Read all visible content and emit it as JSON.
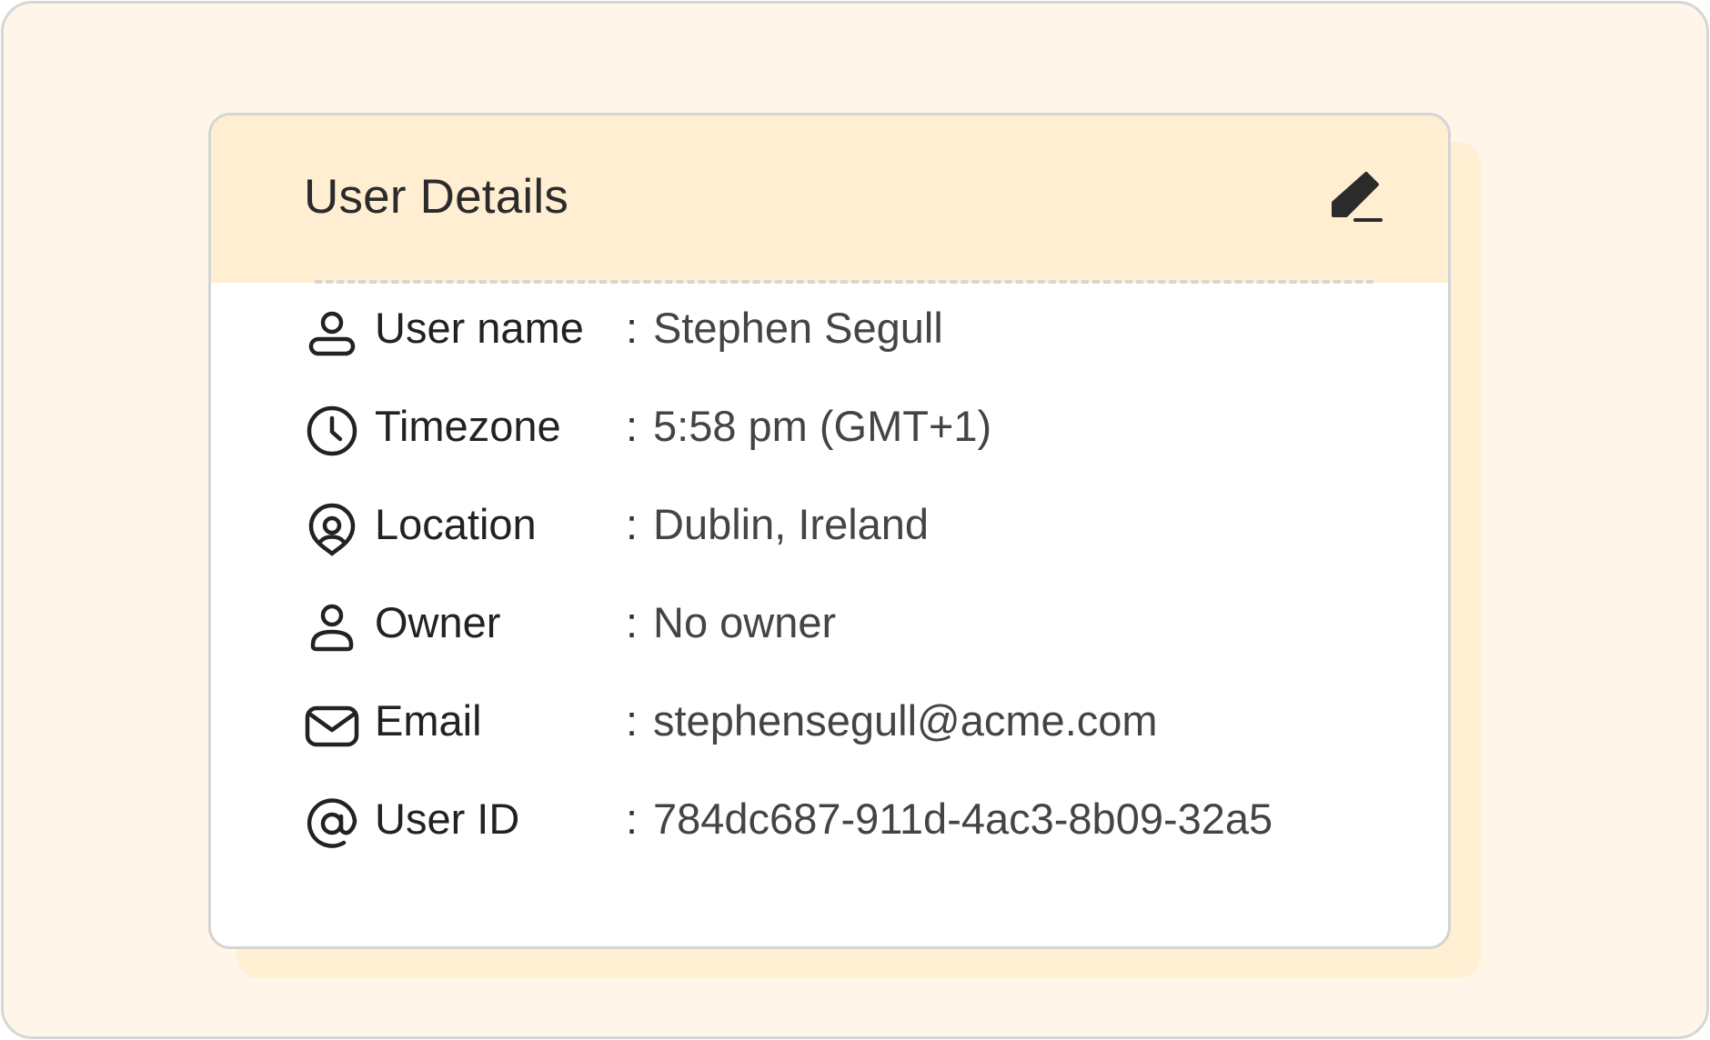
{
  "card": {
    "title": "User Details",
    "edit_icon": "pencil-icon",
    "accent_color": "#ffeed2",
    "background_color": "#fff6e9"
  },
  "fields": [
    {
      "icon": "user-icon",
      "label": "User name",
      "separator": ":",
      "value": "Stephen Segull"
    },
    {
      "icon": "clock-icon",
      "label": "Timezone",
      "separator": ":",
      "value": "5:58 pm (GMT+1)"
    },
    {
      "icon": "location-pin-icon",
      "label": "Location",
      "separator": ":",
      "value": "Dublin, Ireland"
    },
    {
      "icon": "user-icon",
      "label": "Owner",
      "separator": ":",
      "value": "No owner"
    },
    {
      "icon": "envelope-icon",
      "label": "Email",
      "separator": ":",
      "value": "stephensegull@acme.com"
    },
    {
      "icon": "at-sign-icon",
      "label": "User ID",
      "separator": ":",
      "value": "784dc687-911d-4ac3-8b09-32a5"
    }
  ]
}
